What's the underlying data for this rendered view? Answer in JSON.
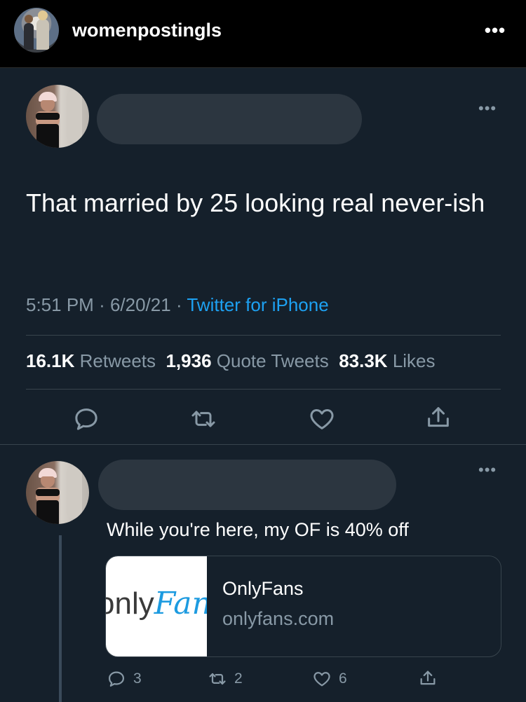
{
  "instagram": {
    "username": "womenpostingls",
    "more_label": "•••"
  },
  "tweet": {
    "more_label": "•••",
    "text": "That married by 25 looking real never-ish",
    "time": "5:51 PM",
    "date": "6/20/21",
    "source": "Twitter for iPhone",
    "stats": {
      "retweets_count": "16.1K",
      "retweets_label": "Retweets",
      "quotes_count": "1,936",
      "quotes_label": "Quote Tweets",
      "likes_count": "83.3K",
      "likes_label": "Likes"
    }
  },
  "reply": {
    "more_label": "•••",
    "text": "While you're here, my OF is 40% off",
    "card": {
      "logo_part1": "onlyFans",
      "title": "OnlyFans",
      "domain": "onlyfans.com"
    },
    "counts": {
      "replies": "3",
      "retweets": "2",
      "likes": "6"
    }
  },
  "icons": [
    "reply-icon",
    "retweet-icon",
    "heart-icon",
    "share-icon"
  ],
  "colors": {
    "background": "#15202b",
    "topbar": "#000000",
    "link": "#1da1f2",
    "muted": "#8899a6"
  }
}
